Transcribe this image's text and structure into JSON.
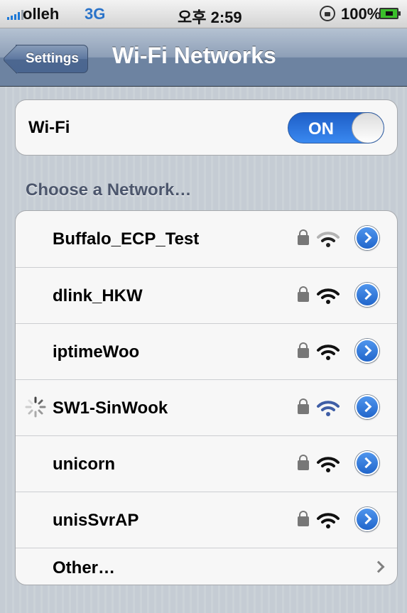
{
  "status_bar": {
    "carrier": "olleh",
    "network_type": "3G",
    "time": "오후 2:59",
    "battery_percent": "100%"
  },
  "nav": {
    "back_label": "Settings",
    "title": "Wi-Fi Networks"
  },
  "wifi": {
    "label": "Wi-Fi",
    "toggle": "ON"
  },
  "section_header": "Choose a Network…",
  "networks": [
    {
      "name": "Buffalo_ECP_Test",
      "locked": true,
      "signal": "weak",
      "connecting": false
    },
    {
      "name": "dlink_HKW",
      "locked": true,
      "signal": "strong",
      "connecting": false
    },
    {
      "name": "iptimeWoo",
      "locked": true,
      "signal": "strong",
      "connecting": false
    },
    {
      "name": "SW1-SinWook",
      "locked": true,
      "signal": "strong-selected",
      "connecting": true
    },
    {
      "name": "unicorn",
      "locked": true,
      "signal": "strong",
      "connecting": false
    },
    {
      "name": "unisSvrAP",
      "locked": true,
      "signal": "strong",
      "connecting": false
    }
  ],
  "other": {
    "label": "Other…"
  },
  "colors": {
    "accent": "#2a73c9",
    "toggle_on": "#2f7ce6",
    "section_header": "#4c566c"
  }
}
